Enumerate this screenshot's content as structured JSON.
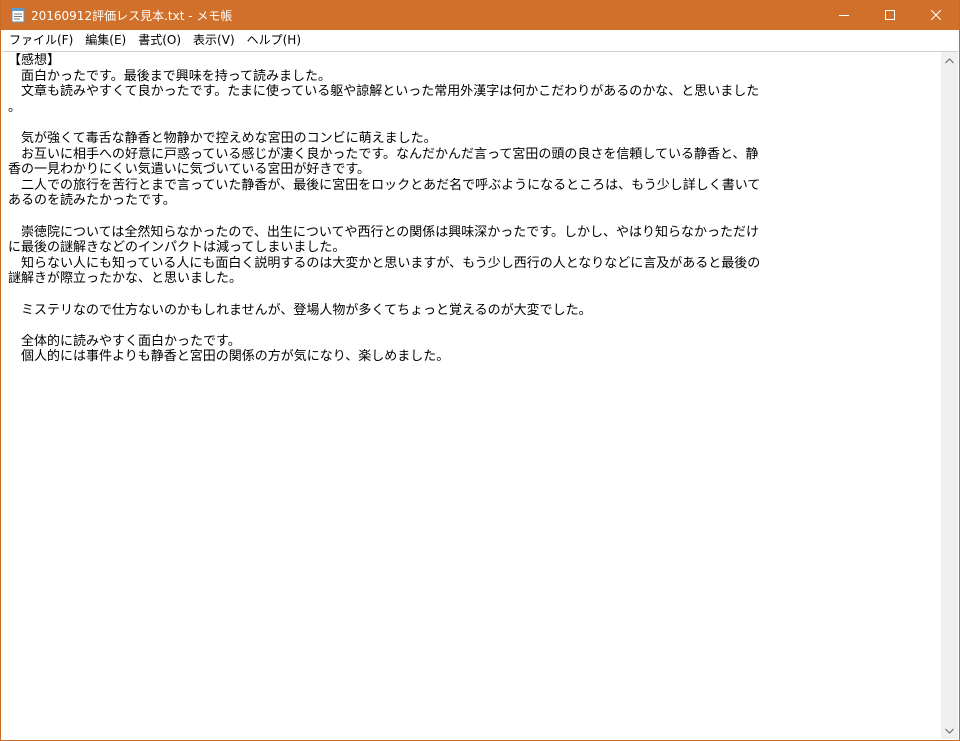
{
  "window": {
    "title": "20160912評価レス見本.txt - メモ帳"
  },
  "menu": [
    {
      "label": "ファイル(F)"
    },
    {
      "label": "編集(E)"
    },
    {
      "label": "書式(O)"
    },
    {
      "label": "表示(V)"
    },
    {
      "label": "ヘルプ(H)"
    }
  ],
  "document": {
    "lines": [
      "【感想】",
      "　面白かったです。最後まで興味を持って読みました。",
      "　文章も読みやすくて良かったです。たまに使っている躯や諒解といった常用外漢字は何かこだわりがあるのかな、と思いました",
      "。",
      "",
      "　気が強くて毒舌な静香と物静かで控えめな宮田のコンビに萌えました。",
      "　お互いに相手への好意に戸惑っている感じが凄く良かったです。なんだかんだ言って宮田の頭の良さを信頼している静香と、静",
      "香の一見わかりにくい気遣いに気づいている宮田が好きです。",
      "　二人での旅行を苦行とまで言っていた静香が、最後に宮田をロックとあだ名で呼ぶようになるところは、もう少し詳しく書いて",
      "あるのを読みたかったです。",
      "",
      "　崇徳院については全然知らなかったので、出生についてや西行との関係は興味深かったです。しかし、やはり知らなかっただけ",
      "に最後の謎解きなどのインパクトは減ってしまいました。",
      "　知らない人にも知っている人にも面白く説明するのは大変かと思いますが、もう少し西行の人となりなどに言及があると最後の",
      "謎解きが際立ったかな、と思いました。",
      "",
      "　ミステリなので仕方ないのかもしれませんが、登場人物が多くてちょっと覚えるのが大変でした。",
      "",
      "　全体的に読みやすく面白かったです。",
      "　個人的には事件よりも静香と宮田の関係の方が気になり、楽しめました。"
    ]
  },
  "colors": {
    "titlebar": "#d0702a",
    "text": "#000000",
    "background": "#ffffff"
  },
  "icons": {
    "app": "notepad-icon",
    "minimize": "minimize-icon",
    "maximize": "maximize-icon",
    "close": "close-icon",
    "scroll_up": "scroll-up-arrow-icon",
    "scroll_down": "scroll-down-arrow-icon"
  }
}
